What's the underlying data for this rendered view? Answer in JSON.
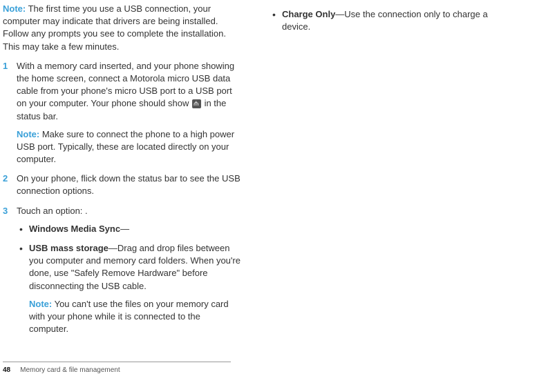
{
  "leftColumn": {
    "introNoteLabel": "Note:",
    "introNoteText": " The first time you use a USB connection, your computer may indicate that drivers are being installed. Follow any prompts you see to complete the installation. This may take a few minutes.",
    "steps": [
      {
        "num": "1",
        "textBefore": "With a memory card inserted, and your phone showing the home screen, connect a Motorola micro USB data cable from your phone's micro USB port to a USB port on your computer. Your phone should show ",
        "textAfter": " in the status bar.",
        "noteLabel": "Note:",
        "noteText": " Make sure to connect the phone to a high power USB port. Typically, these are located directly on your computer."
      },
      {
        "num": "2",
        "text": "On your phone, flick down the status bar to see the USB connection options."
      },
      {
        "num": "3",
        "text": "Touch an option: .",
        "bullets": [
          {
            "bold": "Windows Media Sync",
            "tail": "—"
          },
          {
            "bold": "USB mass storage",
            "tail": "—Drag and drop files between you computer and memory card folders. When you're done, use \"Safely Remove Hardware\" before disconnecting the USB cable.",
            "subNoteLabel": "Note:",
            "subNoteText": "  You can't use the files on your memory card with your phone while it is connected to the computer."
          }
        ]
      }
    ]
  },
  "rightColumn": {
    "bullet": {
      "bold": "Charge Only",
      "tail": "—Use the connection only to charge a device."
    }
  },
  "footer": {
    "pageNumber": "48",
    "section": "Memory card & file management"
  }
}
